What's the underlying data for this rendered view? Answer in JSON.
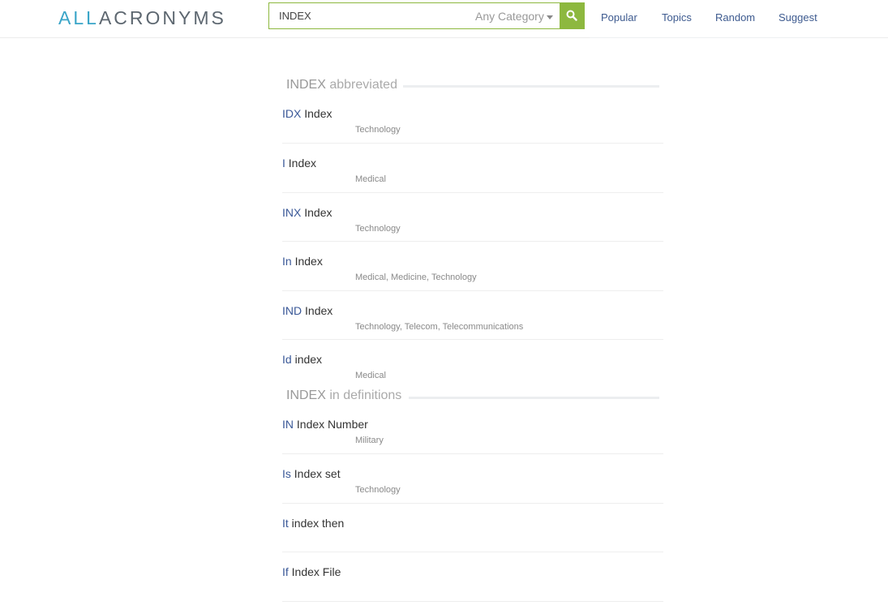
{
  "header": {
    "logo_all": "ALL",
    "logo_rest": "ACRONYMS",
    "search_value": "INDEX",
    "category_label": "Any Category",
    "nav": [
      "Popular",
      "Topics",
      "Random",
      "Suggest"
    ]
  },
  "abbreviated": {
    "term": "INDEX",
    "suffix": " abbreviated",
    "entries": [
      {
        "abbr": "IDX",
        "meaning": "Index",
        "categories": "Technology"
      },
      {
        "abbr": "I",
        "meaning": "Index",
        "categories": "Medical"
      },
      {
        "abbr": "INX",
        "meaning": "Index",
        "categories": "Technology"
      },
      {
        "abbr": "In",
        "meaning": "Index",
        "categories": "Medical, Medicine, Technology"
      },
      {
        "abbr": "IND",
        "meaning": "Index",
        "categories": "Technology, Telecom, Telecommunications"
      },
      {
        "abbr": "Id",
        "meaning": "index",
        "categories": "Medical"
      }
    ]
  },
  "definitions": {
    "term": "INDEX",
    "suffix": " in definitions",
    "entries": [
      {
        "abbr": "IN",
        "meaning": "Index Number",
        "categories": "Military"
      },
      {
        "abbr": "Is",
        "meaning": "Index set",
        "categories": "Technology"
      },
      {
        "abbr": "It",
        "meaning": "index then",
        "categories": ""
      },
      {
        "abbr": "If",
        "meaning": "Index File",
        "categories": ""
      }
    ]
  },
  "colors": {
    "accent": "#8db83f",
    "link": "#3b5998",
    "logo_all": "#3aa5c8",
    "logo_rest": "#5d6770"
  },
  "icons": {
    "search": "search-icon",
    "caret": "caret-down-icon"
  }
}
